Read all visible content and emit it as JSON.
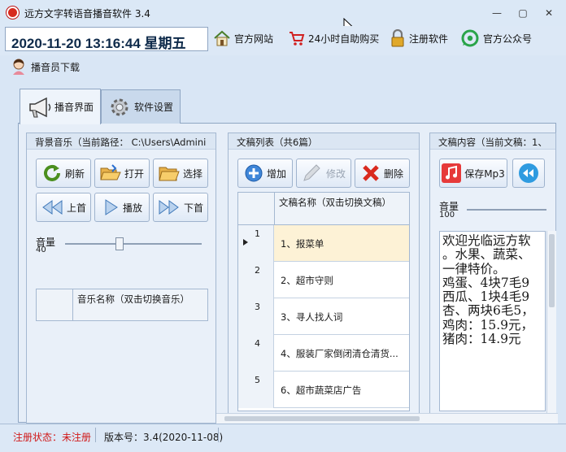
{
  "app": {
    "title": "远方文字转语音播音软件 3.4"
  },
  "window_controls": {
    "minimize": "—",
    "restore": "▢",
    "close": "✕"
  },
  "header": {
    "datetime": "2020-11-20 13:16:44 星期五"
  },
  "toolbar": {
    "official_site": "官方网站",
    "buy_24h": "24小时自助购买",
    "register": "注册软件",
    "wechat": "官方公众号"
  },
  "downloader": {
    "label": "播音员下载"
  },
  "tabs": [
    {
      "label": "播音界面"
    },
    {
      "label": "软件设置"
    }
  ],
  "bg_music": {
    "title": "背景音乐（当前路径： C:\\Users\\Admini",
    "buttons": {
      "refresh": "刷新",
      "open": "打开",
      "select": "选择",
      "prev": "上首",
      "play": "播放",
      "next": "下首"
    },
    "volume_label": "音量",
    "volume_value": "40",
    "volume_level": 0.4,
    "table_header": "音乐名称（双击切换音乐）"
  },
  "doc_list": {
    "title": "文稿列表（共6篇）",
    "buttons": {
      "add": "增加",
      "edit": "修改",
      "delete": "删除"
    },
    "header": "文稿名称（双击切换文稿）",
    "rows": [
      {
        "num": "1",
        "name": "1、报菜单"
      },
      {
        "num": "2",
        "name": "2、超市守则"
      },
      {
        "num": "3",
        "name": "3、寻人找人词"
      },
      {
        "num": "4",
        "name": "4、服装厂家倒闭清仓清货..."
      },
      {
        "num": "5",
        "name": "6、超市蔬菜店广告"
      }
    ]
  },
  "doc_content": {
    "title": "文稿内容（当前文稿：1、",
    "save_mp3": "保存Mp3",
    "volume_label": "音量",
    "volume_value": "100",
    "volume_level": 1.0,
    "text": "欢迎光临远方软\n。水果、蔬菜、\n一律特价。\n鸡蛋、4块7毛9\n西瓜、1块4毛9\n杏、两块6毛5，\n鸡肉：15.9元，\n猪肉：14.9元"
  },
  "status": {
    "registration": "注册状态：未注册",
    "version": "版本号：3.4(2020-11-08)"
  }
}
